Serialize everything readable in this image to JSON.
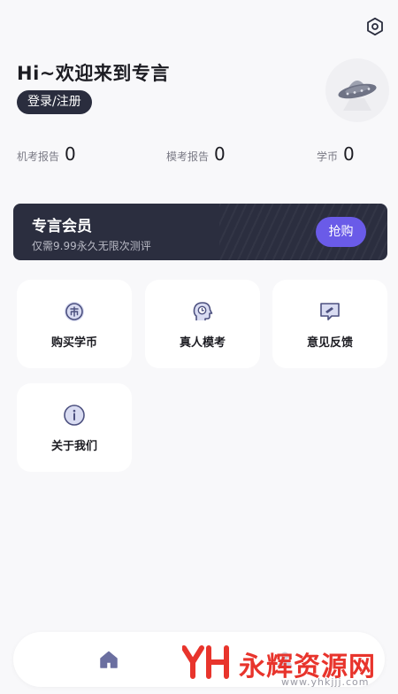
{
  "header": {
    "greeting": "Hi~欢迎来到专言",
    "login_label": "登录/注册",
    "settings_icon": "settings-hexagon-icon",
    "avatar_icon": "ufo-icon"
  },
  "stats": [
    {
      "label": "机考报告",
      "value": "0"
    },
    {
      "label": "模考报告",
      "value": "0"
    },
    {
      "label": "学币",
      "value": "0"
    }
  ],
  "vip": {
    "title": "专言会员",
    "subtitle": "仅需9.99永久无限次测评",
    "button": "抢购"
  },
  "menu": [
    {
      "label": "购买学币",
      "icon": "coin-icon"
    },
    {
      "label": "真人模考",
      "icon": "head-clock-icon"
    },
    {
      "label": "意见反馈",
      "icon": "feedback-chat-icon"
    },
    {
      "label": "关于我们",
      "icon": "info-icon"
    }
  ],
  "tabbar": {
    "home_icon": "home-icon",
    "mine_icon": "user-icon"
  },
  "watermark": {
    "logo": "YH",
    "text": "永辉资源网",
    "url": "www.yhkjjj.com"
  },
  "colors": {
    "accent": "#6a5be8",
    "dark": "#2b2e3f",
    "icon": "#6b6fa0",
    "watermark": "#e8342c"
  }
}
